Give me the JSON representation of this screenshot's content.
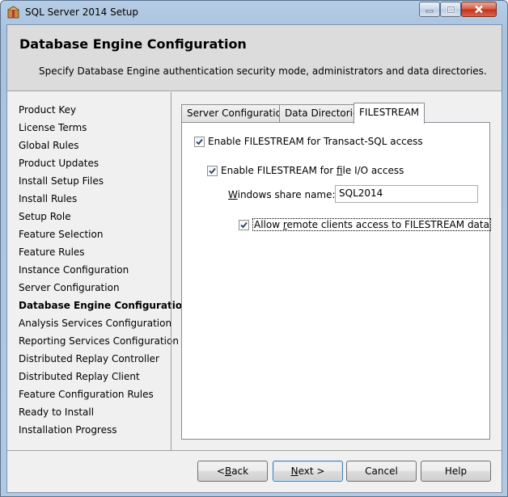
{
  "window": {
    "title": "SQL Server 2014 Setup"
  },
  "header": {
    "title": "Database Engine Configuration",
    "description": "Specify Database Engine authentication security mode, administrators and data directories."
  },
  "nav": {
    "items": [
      "Product Key",
      "License Terms",
      "Global Rules",
      "Product Updates",
      "Install Setup Files",
      "Install Rules",
      "Setup Role",
      "Feature Selection",
      "Feature Rules",
      "Instance Configuration",
      "Server Configuration",
      "Database Engine Configuration",
      "Analysis Services Configuration",
      "Reporting Services Configuration",
      "Distributed Replay Controller",
      "Distributed Replay Client",
      "Feature Configuration Rules",
      "Ready to Install",
      "Installation Progress"
    ],
    "active_index": 11
  },
  "tabs": {
    "server_configuration": "Server Configuration",
    "data_directories": "Data Directories",
    "filestream": "FILESTREAM",
    "active": "FILESTREAM"
  },
  "filestream": {
    "enable_tsql": {
      "label": "Enable FILESTREAM for Transact-SQL access",
      "checked": true
    },
    "enable_file_io": {
      "label_pre": "Enable FILESTREAM for ",
      "label_u": "f",
      "label_post": "ile I/O access",
      "checked": true
    },
    "share_name": {
      "label_u": "W",
      "label_post": "indows share name:",
      "value": "SQL2014"
    },
    "allow_remote": {
      "label_pre": "Allow ",
      "label_u": "r",
      "label_post": "emote clients access to FILESTREAM data",
      "checked": true
    }
  },
  "buttons": {
    "back_pre": "< ",
    "back_u": "B",
    "back_post": "ack",
    "next_u": "N",
    "next_post": "ext >",
    "cancel": "Cancel",
    "help": "Help"
  },
  "icons": {
    "app": "sql-setup-box-icon",
    "minimize": "minimize-icon",
    "maximize": "maximize-icon",
    "close": "close-icon",
    "check": "checkmark-icon"
  }
}
